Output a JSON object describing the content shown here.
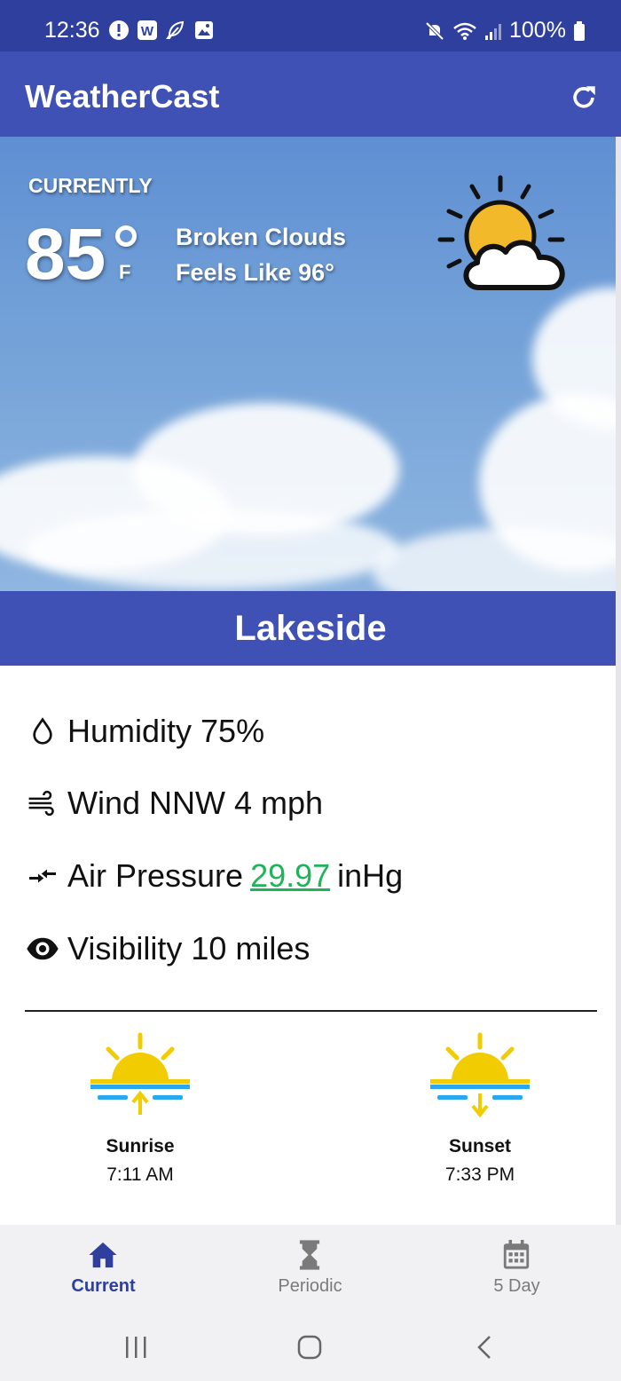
{
  "status_bar": {
    "time": "12:36",
    "battery": "100%"
  },
  "app": {
    "title": "WeatherCast"
  },
  "current": {
    "heading": "CURRENTLY",
    "temperature": "85",
    "unit": "F",
    "condition": "Broken Clouds",
    "feels_like": "Feels Like 96°"
  },
  "location": {
    "name": "Lakeside"
  },
  "details": {
    "humidity": "Humidity 75%",
    "wind": "Wind NNW 4 mph",
    "pressure_label": "Air Pressure",
    "pressure_value": "29.97",
    "pressure_unit": "inHg",
    "visibility": "Visibility 10 miles"
  },
  "sun": {
    "sunrise_label": "Sunrise",
    "sunrise_time": "7:11 AM",
    "sunset_label": "Sunset",
    "sunset_time": "7:33 PM"
  },
  "nav": {
    "items": [
      {
        "label": "Current",
        "icon": "home-icon",
        "active": true
      },
      {
        "label": "Periodic",
        "icon": "hourglass-icon",
        "active": false
      },
      {
        "label": "5 Day",
        "icon": "calendar-icon",
        "active": false
      }
    ]
  },
  "colors": {
    "primary": "#3f51b5",
    "status_bar": "#2f3f9e",
    "accent_green": "#1fb35a",
    "sun_yellow": "#f0cc00",
    "water_blue": "#29a8f0",
    "nav_active": "#2f3f9e",
    "nav_inactive": "#7a7a7a"
  }
}
